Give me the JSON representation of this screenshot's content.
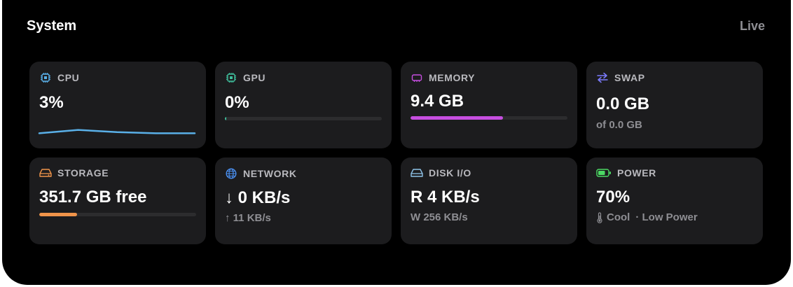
{
  "header": {
    "title": "System",
    "status": "Live"
  },
  "cards": {
    "cpu": {
      "label": "CPU",
      "value": "3%",
      "icon": "cpu-chip-icon",
      "color": "#5ab0e8",
      "history_percent": [
        1,
        4,
        2,
        1,
        1
      ]
    },
    "gpu": {
      "label": "GPU",
      "value": "0%",
      "icon": "gpu-chip-icon",
      "color": "#3fbf9c",
      "fill_fraction": 0.01
    },
    "memory": {
      "label": "MEMORY",
      "value": "9.4 GB",
      "icon": "memory-module-icon",
      "color": "#c64ee0",
      "fill_fraction": 0.59
    },
    "swap": {
      "label": "SWAP",
      "value": "0.0 GB",
      "sub": "of 0.0 GB",
      "icon": "swap-arrows-icon",
      "color": "#7b7bff"
    },
    "storage": {
      "label": "STORAGE",
      "value": "351.7 GB free",
      "icon": "drive-icon",
      "color": "#f0944a",
      "fill_fraction": 0.24
    },
    "network": {
      "label": "NETWORK",
      "value": "↓ 0 KB/s",
      "sub": "↑ 11 KB/s",
      "icon": "globe-icon",
      "color": "#4a8ff0"
    },
    "disk_io": {
      "label": "DISK I/O",
      "value": "R 4 KB/s",
      "sub": "W 256 KB/s",
      "icon": "disk-icon",
      "color": "#8fc3e8"
    },
    "power": {
      "label": "POWER",
      "value": "70%",
      "sub_thermal": "Cool",
      "sub_mode": "· Low Power",
      "icon": "battery-icon",
      "thermal_icon": "thermometer-icon",
      "color": "#4cd964"
    }
  }
}
